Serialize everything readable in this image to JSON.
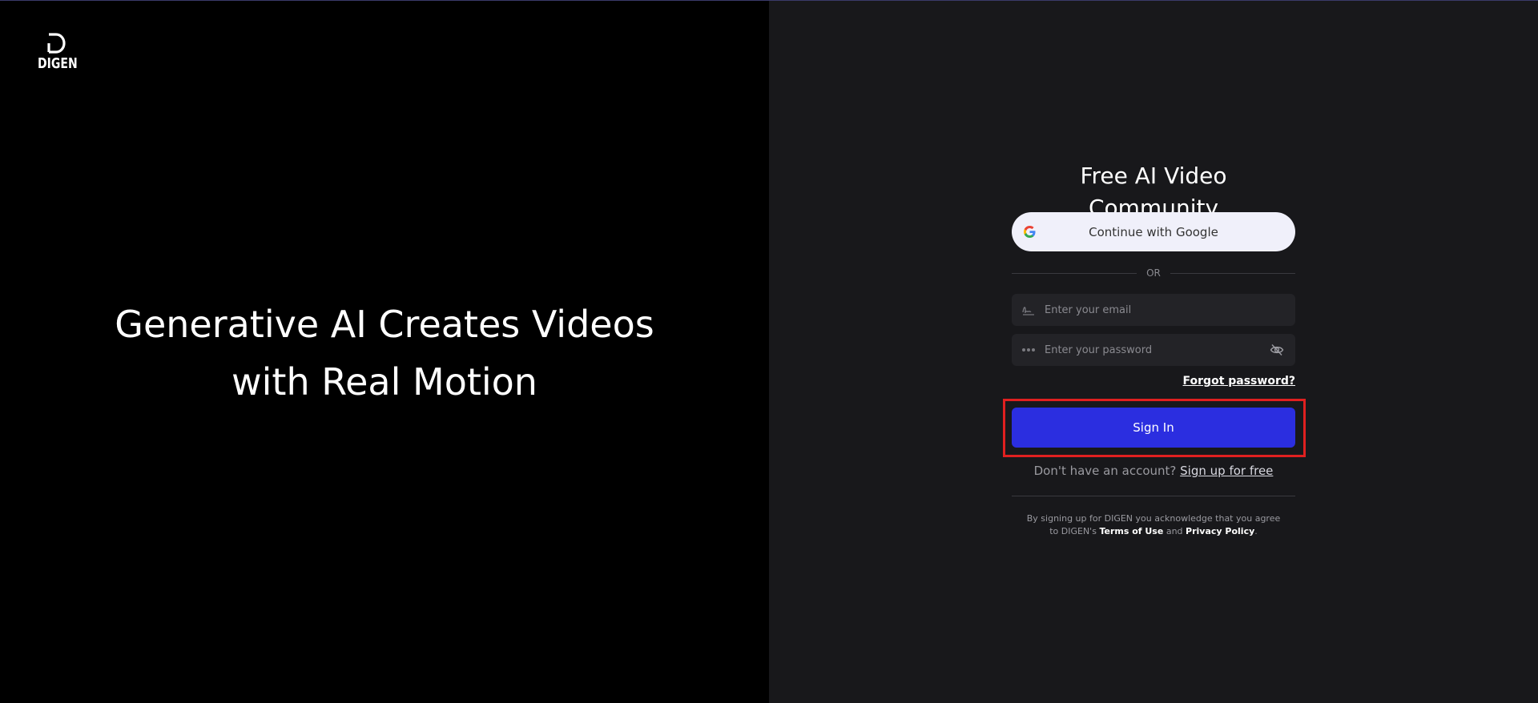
{
  "brand": {
    "logo_text": "DIGEN"
  },
  "hero": {
    "line1": "Generative AI Creates Videos",
    "line2": "with Real Motion"
  },
  "form": {
    "title": "Free AI Video Community",
    "google_label": "Continue with Google",
    "or_label": "OR",
    "email_placeholder": "Enter your email",
    "password_placeholder": "Enter your password",
    "forgot_label": "Forgot password?",
    "signin_label": "Sign In",
    "no_account_text": "Don't have an account?",
    "signup_label": "Sign up for free",
    "legal_line1": "By signing up for DIGEN you acknowledge that you agree",
    "legal_prefix": "to DIGEN's",
    "terms_label": "Terms of Use",
    "and_text": "and",
    "privacy_label": "Privacy Policy",
    "legal_suffix": "."
  },
  "colors": {
    "left_bg": "#000000",
    "right_bg": "#18181b",
    "accent": "#2b2ee0",
    "highlight": "#e02020"
  },
  "icons": {
    "logo": "digen-d-mark",
    "google": "google-g-icon",
    "email": "signature-icon",
    "password": "dots-icon",
    "visibility": "eye-off-icon"
  }
}
